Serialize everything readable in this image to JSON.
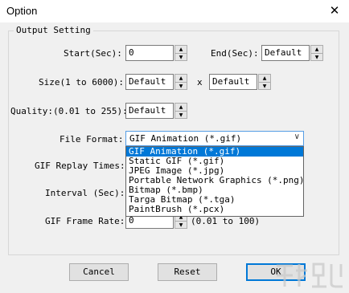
{
  "window": {
    "title": "Option",
    "close_glyph": "✕"
  },
  "group": {
    "label": "Output Setting"
  },
  "start": {
    "label": "Start(Sec):",
    "value": "0"
  },
  "end": {
    "label": "End(Sec):",
    "value": "Default"
  },
  "size": {
    "label": "Size(1 to 6000):",
    "width_value": "Default",
    "separator": "x",
    "height_value": "Default"
  },
  "quality": {
    "label": "Quality:(0.01 to 255):",
    "value": "Default"
  },
  "file_format": {
    "label": "File Format:",
    "selected": "GIF Animation (*.gif)",
    "options": [
      "GIF Animation (*.gif)",
      "Static GIF (*.gif)",
      "JPEG Image (*.jpg)",
      "Portable Network Graphics (*.png)",
      "Bitmap (*.bmp)",
      "Targa Bitmap (*.tga)",
      "PaintBrush (*.pcx)"
    ]
  },
  "gif_replay": {
    "label": "GIF Replay Times:"
  },
  "interval": {
    "label": "Interval (Sec):"
  },
  "frame_rate": {
    "label": "GIF Frame Rate:",
    "value": "0",
    "hint": "(0.01 to 100)"
  },
  "buttons": {
    "cancel": "Cancel",
    "reset": "Reset",
    "ok": "OK"
  },
  "colors": {
    "selection": "#0078d7",
    "client_bg": "#f0f0f0"
  }
}
